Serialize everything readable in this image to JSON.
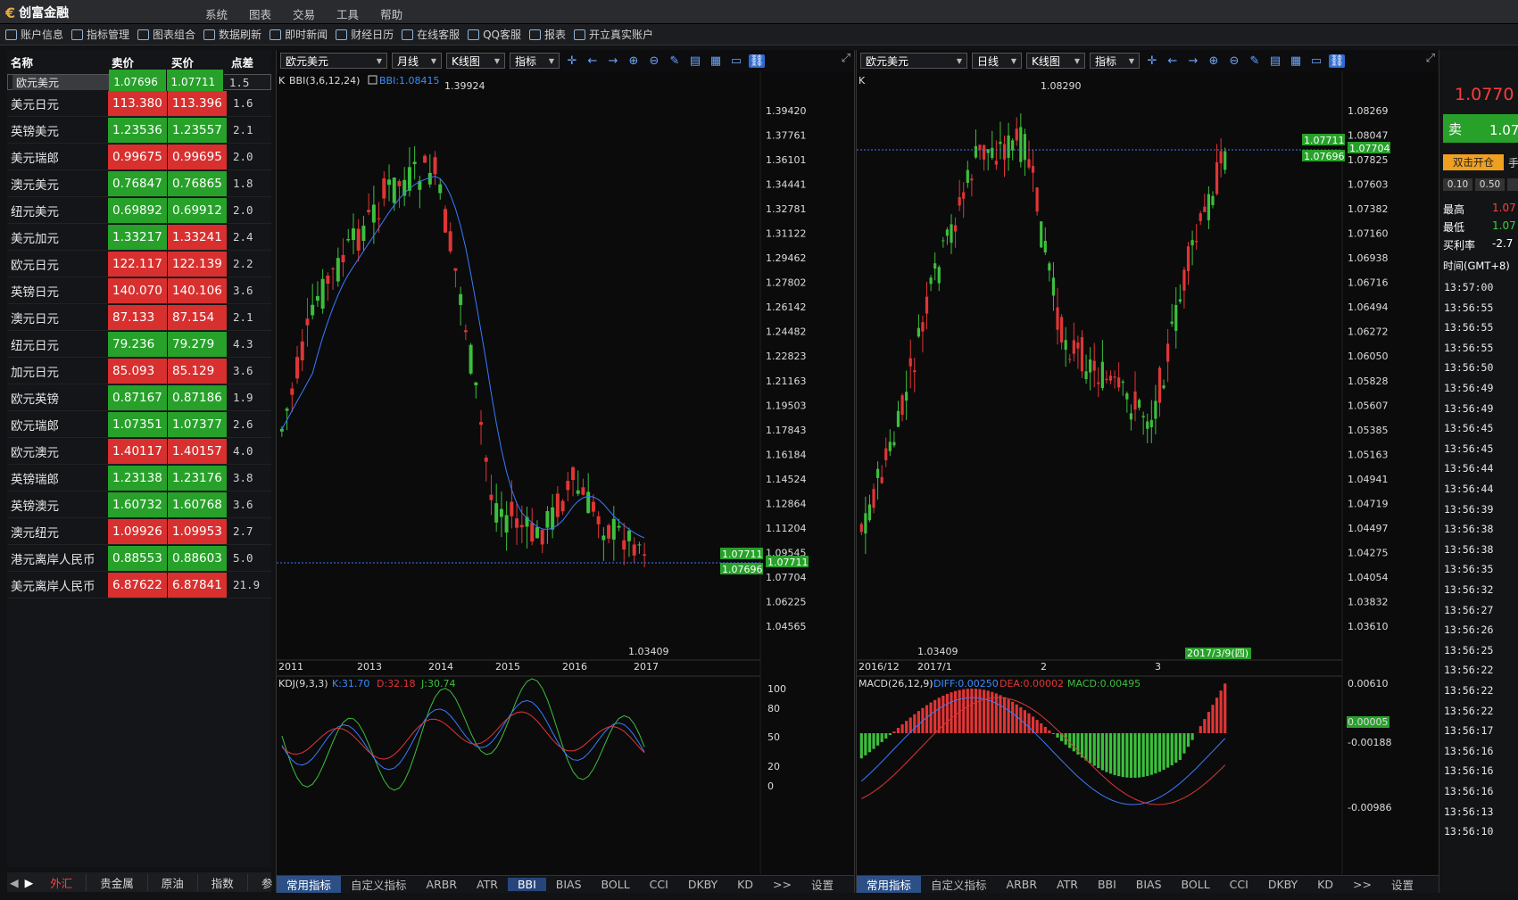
{
  "app": {
    "title": "创富金融",
    "menu": [
      "系统",
      "图表",
      "交易",
      "工具",
      "帮助"
    ]
  },
  "toolbar": [
    "账户信息",
    "指标管理",
    "图表组合",
    "数据刷新",
    "即时新闻",
    "财经日历",
    "在线客服",
    "QQ客服",
    "报表",
    "开立真实账户"
  ],
  "quotes": {
    "headers": [
      "名称",
      "卖价",
      "买价",
      "点差"
    ],
    "rows": [
      {
        "name": "欧元美元",
        "sell": "1.07696",
        "buy": "1.07711",
        "spread": "1.5",
        "sc": "g",
        "bc": "g"
      },
      {
        "name": "美元日元",
        "sell": "113.380",
        "buy": "113.396",
        "spread": "1.6",
        "sc": "r",
        "bc": "r"
      },
      {
        "name": "英镑美元",
        "sell": "1.23536",
        "buy": "1.23557",
        "spread": "2.1",
        "sc": "g",
        "bc": "g"
      },
      {
        "name": "美元瑞郎",
        "sell": "0.99675",
        "buy": "0.99695",
        "spread": "2.0",
        "sc": "r",
        "bc": "r"
      },
      {
        "name": "澳元美元",
        "sell": "0.76847",
        "buy": "0.76865",
        "spread": "1.8",
        "sc": "g",
        "bc": "g"
      },
      {
        "name": "纽元美元",
        "sell": "0.69892",
        "buy": "0.69912",
        "spread": "2.0",
        "sc": "g",
        "bc": "g"
      },
      {
        "name": "美元加元",
        "sell": "1.33217",
        "buy": "1.33241",
        "spread": "2.4",
        "sc": "g",
        "bc": "r"
      },
      {
        "name": "欧元日元",
        "sell": "122.117",
        "buy": "122.139",
        "spread": "2.2",
        "sc": "r",
        "bc": "r"
      },
      {
        "name": "英镑日元",
        "sell": "140.070",
        "buy": "140.106",
        "spread": "3.6",
        "sc": "r",
        "bc": "r"
      },
      {
        "name": "澳元日元",
        "sell": "87.133",
        "buy": "87.154",
        "spread": "2.1",
        "sc": "r",
        "bc": "r"
      },
      {
        "name": "纽元日元",
        "sell": "79.236",
        "buy": "79.279",
        "spread": "4.3",
        "sc": "g",
        "bc": "g"
      },
      {
        "name": "加元日元",
        "sell": "85.093",
        "buy": "85.129",
        "spread": "3.6",
        "sc": "r",
        "bc": "r"
      },
      {
        "name": "欧元英镑",
        "sell": "0.87167",
        "buy": "0.87186",
        "spread": "1.9",
        "sc": "g",
        "bc": "g"
      },
      {
        "name": "欧元瑞郎",
        "sell": "1.07351",
        "buy": "1.07377",
        "spread": "2.6",
        "sc": "g",
        "bc": "g"
      },
      {
        "name": "欧元澳元",
        "sell": "1.40117",
        "buy": "1.40157",
        "spread": "4.0",
        "sc": "r",
        "bc": "r"
      },
      {
        "name": "英镑瑞郎",
        "sell": "1.23138",
        "buy": "1.23176",
        "spread": "3.8",
        "sc": "g",
        "bc": "g"
      },
      {
        "name": "英镑澳元",
        "sell": "1.60732",
        "buy": "1.60768",
        "spread": "3.6",
        "sc": "g",
        "bc": "g"
      },
      {
        "name": "澳元纽元",
        "sell": "1.09926",
        "buy": "1.09953",
        "spread": "2.7",
        "sc": "r",
        "bc": "r"
      },
      {
        "name": "港元离岸人民币",
        "sell": "0.88553",
        "buy": "0.88603",
        "spread": "5.0",
        "sc": "g",
        "bc": "g"
      },
      {
        "name": "美元离岸人民币",
        "sell": "6.87622",
        "buy": "6.87841",
        "spread": "21.9",
        "sc": "r",
        "bc": "r"
      }
    ],
    "tabs": [
      "外汇",
      "贵金属",
      "原油",
      "指数",
      "参"
    ]
  },
  "left": {
    "symbol": "欧元美元",
    "period": "月线",
    "ctype": "K线图",
    "ind": "指标",
    "klabel": "K",
    "bbi": "BBI(3,6,12,24)",
    "bbiv": "BBI:1.08415",
    "yticks": [
      "1.39420",
      "1.37761",
      "1.36101",
      "1.34441",
      "1.32781",
      "1.31122",
      "1.29462",
      "1.27802",
      "1.26142",
      "1.24482",
      "1.22823",
      "1.21163",
      "1.19503",
      "1.17843",
      "1.16184",
      "1.14524",
      "1.12864",
      "1.11204",
      "1.09545",
      "1.07704",
      "1.06225",
      "1.04565"
    ],
    "xticks": [
      "2011",
      "2013",
      "2014",
      "2015",
      "2016",
      "2017"
    ],
    "hi": "1.39924",
    "lo": "1.03409",
    "buy": "1.07711",
    "sell": "1.07696",
    "sub": "KDJ(9,3,3)",
    "k": "K:31.70",
    "d": "D:32.18",
    "j": "J:30.74",
    "subticks": [
      "100",
      "80",
      "50",
      "20",
      "0"
    ]
  },
  "rightc": {
    "symbol": "欧元美元",
    "period": "日线",
    "ctype": "K线图",
    "ind": "指标",
    "klabel": "K",
    "yticks": [
      "1.08269",
      "1.08047",
      "1.07825",
      "1.07603",
      "1.07382",
      "1.07160",
      "1.06938",
      "1.06716",
      "1.06494",
      "1.06272",
      "1.06050",
      "1.05828",
      "1.05607",
      "1.05385",
      "1.05163",
      "1.04941",
      "1.04719",
      "1.04497",
      "1.04275",
      "1.04054",
      "1.03832",
      "1.03610"
    ],
    "xticks": [
      "2016/12",
      "2017/1",
      "2",
      "3"
    ],
    "date": "2017/3/9(四)",
    "hi": "1.08290",
    "lo": "1.03409",
    "buy": "1.07711",
    "last": "1.07704",
    "sell": "1.07696",
    "sub": "MACD(26,12,9)",
    "diff": "DIFF:0.00250",
    "dea": "DEA:0.00002",
    "macd": "MACD:0.00495",
    "subticks": [
      "0.00610",
      "0.00005",
      "-0.00188",
      "-0.00986"
    ]
  },
  "ptabs": [
    "常用指标",
    "自定义指标",
    "ARBR",
    "ATR",
    "BBI",
    "BIAS",
    "BOLL",
    "CCI",
    "DKBY",
    "KD",
    ">>",
    "设置"
  ],
  "side": {
    "price": "1.0770",
    "sell": "卖",
    "sellv": "1.07",
    "dbl": "双击开仓",
    "hand": "手",
    "lot1": "0.10",
    "lot2": "0.50",
    "hiL": "最高",
    "hiV": "1.07",
    "loL": "最低",
    "loV": "1.07",
    "rateL": "买利率",
    "rateV": "-2.7",
    "timeH": "时间(GMT+8)",
    "times": [
      "13:57:00",
      "13:56:55",
      "13:56:55",
      "13:56:55",
      "13:56:50",
      "13:56:49",
      "13:56:49",
      "13:56:45",
      "13:56:45",
      "13:56:44",
      "13:56:44",
      "13:56:39",
      "13:56:38",
      "13:56:38",
      "13:56:35",
      "13:56:32",
      "13:56:27",
      "13:56:26",
      "13:56:25",
      "13:56:22",
      "13:56:22",
      "13:56:22",
      "13:56:17",
      "13:56:16",
      "13:56:16",
      "13:56:16",
      "13:56:13",
      "13:56:10"
    ]
  }
}
